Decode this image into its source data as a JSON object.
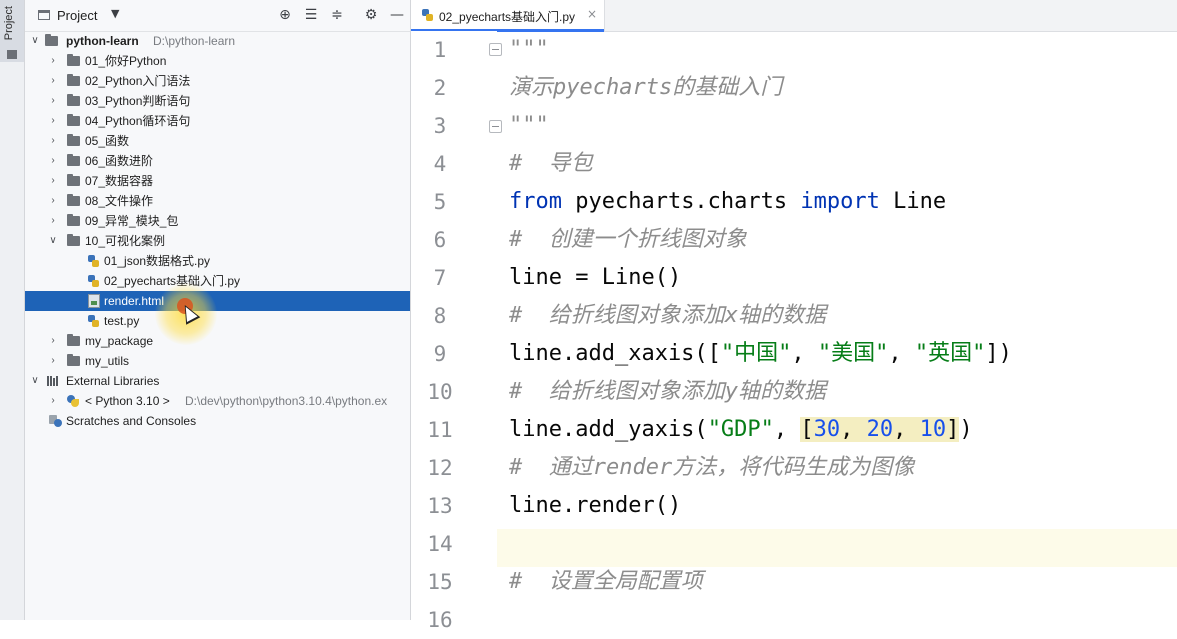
{
  "toolstrip": {
    "label": "Project"
  },
  "project_panel": {
    "title": "Project",
    "tree": [
      {
        "label": "python-learn",
        "hint": "D:\\python-learn",
        "type": "folder",
        "expanded": true,
        "level": 0
      },
      {
        "label": "01_你好Python",
        "type": "folder",
        "level": 1
      },
      {
        "label": "02_Python入门语法",
        "type": "folder",
        "level": 1
      },
      {
        "label": "03_Python判断语句",
        "type": "folder",
        "level": 1
      },
      {
        "label": "04_Python循环语句",
        "type": "folder",
        "level": 1
      },
      {
        "label": "05_函数",
        "type": "folder",
        "level": 1
      },
      {
        "label": "06_函数进阶",
        "type": "folder",
        "level": 1
      },
      {
        "label": "07_数据容器",
        "type": "folder",
        "level": 1
      },
      {
        "label": "08_文件操作",
        "type": "folder",
        "level": 1
      },
      {
        "label": "09_异常_模块_包",
        "type": "folder",
        "level": 1
      },
      {
        "label": "10_可视化案例",
        "type": "folder",
        "expanded": true,
        "level": 1
      },
      {
        "label": "01_json数据格式.py",
        "type": "py",
        "level": 2
      },
      {
        "label": "02_pyecharts基础入门.py",
        "type": "py",
        "level": 2
      },
      {
        "label": "render.html",
        "type": "html",
        "level": 2,
        "selected": true
      },
      {
        "label": "test.py",
        "type": "py",
        "level": 2
      },
      {
        "label": "my_package",
        "type": "folder",
        "level": 1
      },
      {
        "label": "my_utils",
        "type": "folder",
        "level": 1
      },
      {
        "label": "External Libraries",
        "type": "lib",
        "expanded": true,
        "level": 0
      },
      {
        "label": "< Python 3.10 >",
        "hint": "D:\\dev\\python\\python3.10.4\\python.ex",
        "type": "python",
        "level": 1
      },
      {
        "label": "Scratches and Consoles",
        "type": "scratch",
        "level": 0
      }
    ]
  },
  "editor": {
    "tab": {
      "label": "02_pyecharts基础入门.py",
      "close": "×"
    },
    "current_line": 14,
    "lines": [
      {
        "n": "1"
      },
      {
        "n": "2"
      },
      {
        "n": "3"
      },
      {
        "n": "4"
      },
      {
        "n": "5"
      },
      {
        "n": "6"
      },
      {
        "n": "7"
      },
      {
        "n": "8"
      },
      {
        "n": "9"
      },
      {
        "n": "10"
      },
      {
        "n": "11"
      },
      {
        "n": "12"
      },
      {
        "n": "13"
      },
      {
        "n": "14"
      },
      {
        "n": "15"
      },
      {
        "n": "16"
      }
    ],
    "code": {
      "l1": "\"\"\"",
      "l2": "演示pyecharts的基础入门",
      "l3": "\"\"\"",
      "l4": "#  导包",
      "l5_kw1": "from",
      "l5_mid": " pyecharts.charts ",
      "l5_kw2": "import",
      "l5_end": " Line",
      "l6": "#  创建一个折线图对象",
      "l7": "line = Line()",
      "l8": "#  给折线图对象添加x轴的数据",
      "l9_a": "line.add_xaxis([",
      "l9_s1": "\"中国\"",
      "l9_c1": ", ",
      "l9_s2": "\"美国\"",
      "l9_c2": ", ",
      "l9_s3": "\"英国\"",
      "l9_b": "])",
      "l10": "#  给折线图对象添加y轴的数据",
      "l11_a": "line.add_yaxis(",
      "l11_s": "\"GDP\"",
      "l11_c": ", ",
      "l11_lb": "[",
      "l11_n1": "30",
      "l11_c1": ", ",
      "l11_n2": "20",
      "l11_c2": ", ",
      "l11_n3": "10",
      "l11_rb": "]",
      "l11_end": ")",
      "l12": "#  通过render方法，将代码生成为图像",
      "l13": "line.render()",
      "l14": "",
      "l15": "#  设置全局配置项"
    }
  }
}
